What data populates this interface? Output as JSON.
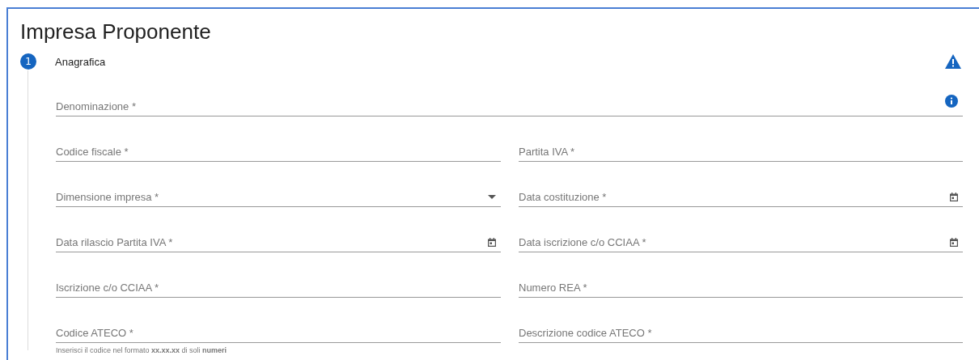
{
  "title": "Impresa Proponente",
  "step": {
    "number": "1",
    "label": "Anagrafica",
    "warning": true
  },
  "fields": [
    {
      "label": "Denominazione *",
      "kind": "text",
      "full": true,
      "info": true
    },
    {
      "label": "Codice fiscale *",
      "kind": "text"
    },
    {
      "label": "Partita IVA *",
      "kind": "text"
    },
    {
      "label": "Dimensione impresa *",
      "kind": "select"
    },
    {
      "label": "Data costituzione *",
      "kind": "date"
    },
    {
      "label": "Data rilascio Partita IVA *",
      "kind": "date"
    },
    {
      "label": "Data iscrizione c/o CCIAA *",
      "kind": "date"
    },
    {
      "label": "Iscrizione c/o CCIAA *",
      "kind": "text"
    },
    {
      "label": "Numero REA *",
      "kind": "text"
    },
    {
      "label": "Codice ATECO *",
      "kind": "text",
      "hint": "Inserisci il codice nel formato **xx.xx.xx** di soli **numeri**"
    },
    {
      "label": "Descrizione codice ATECO *",
      "kind": "text"
    }
  ]
}
